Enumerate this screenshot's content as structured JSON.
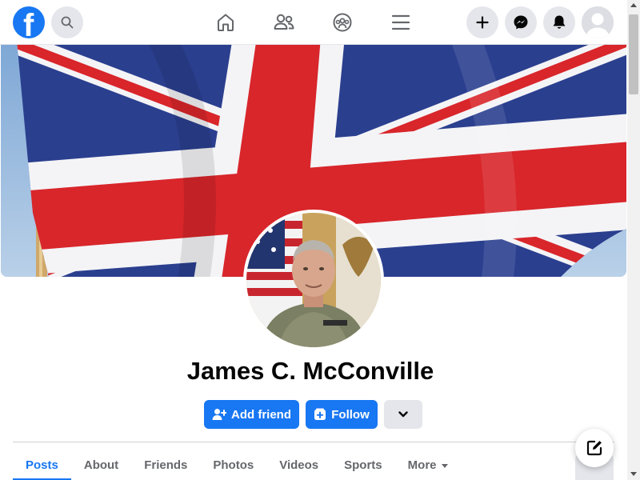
{
  "app": {
    "brand_icon": "facebook-logo-icon",
    "accent_color": "#1877f2"
  },
  "topbar": {
    "search_icon": "search-icon",
    "nav": [
      {
        "name": "home",
        "icon": "home-icon"
      },
      {
        "name": "friends",
        "icon": "friends-icon"
      },
      {
        "name": "groups",
        "icon": "groups-icon"
      },
      {
        "name": "menu",
        "icon": "hamburger-icon"
      }
    ],
    "actions": [
      {
        "name": "create",
        "icon": "plus-icon"
      },
      {
        "name": "messenger",
        "icon": "messenger-icon"
      },
      {
        "name": "notifications",
        "icon": "bell-icon"
      },
      {
        "name": "account",
        "icon": "avatar-icon"
      }
    ]
  },
  "profile": {
    "name": "James C. McConville",
    "buttons": {
      "add_friend": "Add friend",
      "follow": "Follow"
    }
  },
  "tabs": [
    {
      "label": "Posts",
      "active": true
    },
    {
      "label": "About",
      "active": false
    },
    {
      "label": "Friends",
      "active": false
    },
    {
      "label": "Photos",
      "active": false
    },
    {
      "label": "Videos",
      "active": false
    },
    {
      "label": "Sports",
      "active": false
    },
    {
      "label": "More",
      "active": false
    }
  ]
}
